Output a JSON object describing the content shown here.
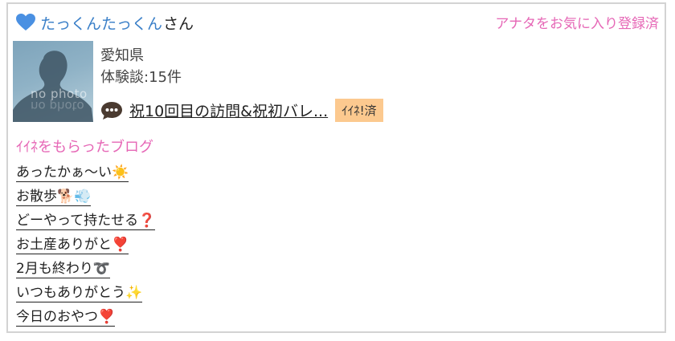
{
  "profile": {
    "username": "たっくんたっくん",
    "honorific": "さん",
    "favorite_status": "アナタをお気に入り登録済",
    "avatar_placeholder": "no photo",
    "prefecture": "愛知県",
    "experience_count": "体験談:15件"
  },
  "latest_post": {
    "title": "祝10回目の訪問&祝初バレ...",
    "badge": "ｲｲﾈ!済"
  },
  "liked_blogs": {
    "heading": "ｲｲﾈをもらったブログ",
    "items": [
      "あったかぁ〜い☀️",
      "お散歩🐕💨",
      "どーやって持たせる❓",
      "お土産ありがと❣️",
      "2月も終わり➰",
      "いつもありがとう✨",
      "今日のおやつ❣️"
    ]
  },
  "colors": {
    "accent_pink": "#e667b6",
    "username_blue": "#3a7fc8",
    "heart_blue": "#4a90e2",
    "badge_orange": "#fcc98f"
  }
}
